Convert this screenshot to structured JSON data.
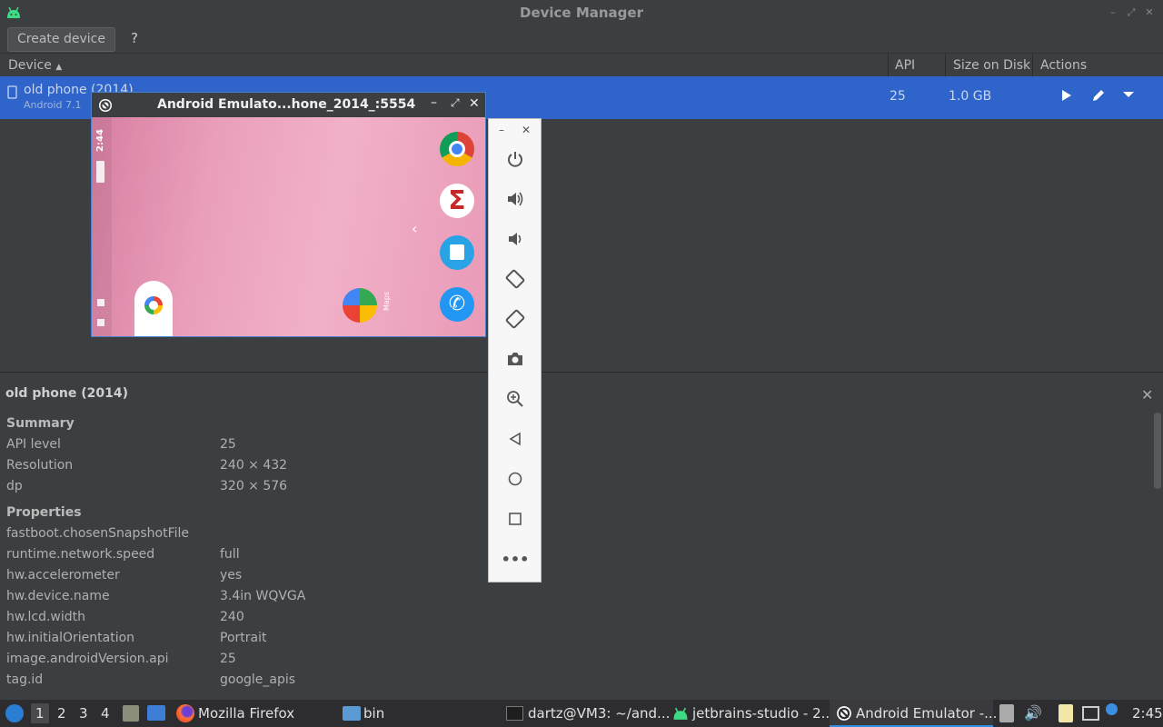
{
  "window": {
    "title": "Device Manager"
  },
  "toolbar": {
    "create_label": "Create device",
    "help_label": "?"
  },
  "table": {
    "columns": {
      "device": "Device",
      "api": "API",
      "size": "Size on Disk",
      "actions": "Actions"
    },
    "row": {
      "name": "old phone (2014)",
      "subtitle": "Android 7.1",
      "api": "25",
      "size": "1.0 GB"
    }
  },
  "emulator": {
    "title": "Android Emulato...hone_2014_:5554",
    "status_time": "2:44",
    "maps_label": "Maps",
    "apps": [
      "chrome-icon",
      "sigma-icon",
      "messages-icon",
      "phone-icon",
      "maps-icon",
      "google-icon"
    ]
  },
  "sidebar_controls": [
    "power-icon",
    "volume-up-icon",
    "volume-down-icon",
    "rotate-left-icon",
    "rotate-right-icon",
    "camera-icon",
    "zoom-icon",
    "back-icon",
    "home-icon",
    "overview-icon",
    "more-icon"
  ],
  "details": {
    "title": "old phone (2014)",
    "summary_heading": "Summary",
    "summary": [
      {
        "label": "API level",
        "value": "25"
      },
      {
        "label": "Resolution",
        "value": "240 × 432"
      },
      {
        "label": "dp",
        "value": "320 × 576"
      }
    ],
    "properties_heading": "Properties",
    "properties": [
      {
        "label": "fastboot.chosenSnapshotFile",
        "value": ""
      },
      {
        "label": "runtime.network.speed",
        "value": "full"
      },
      {
        "label": "hw.accelerometer",
        "value": "yes"
      },
      {
        "label": "hw.device.name",
        "value": "3.4in WQVGA"
      },
      {
        "label": "hw.lcd.width",
        "value": "240"
      },
      {
        "label": "hw.initialOrientation",
        "value": "Portrait"
      },
      {
        "label": "image.androidVersion.api",
        "value": "25"
      },
      {
        "label": "tag.id",
        "value": "google_apis"
      }
    ]
  },
  "taskbar": {
    "workspaces": [
      "1",
      "2",
      "3",
      "4"
    ],
    "tasks": [
      {
        "label": "Mozilla Firefox"
      },
      {
        "label": "bin"
      },
      {
        "label": "dartz@VM3: ~/and..."
      },
      {
        "label": "jetbrains-studio - 2..."
      },
      {
        "label": "Android Emulator -..."
      }
    ],
    "clock": "2:45"
  },
  "colors": {
    "selection": "#2f65ca",
    "panel": "#3c3f41",
    "text": "#bbbbbb"
  }
}
